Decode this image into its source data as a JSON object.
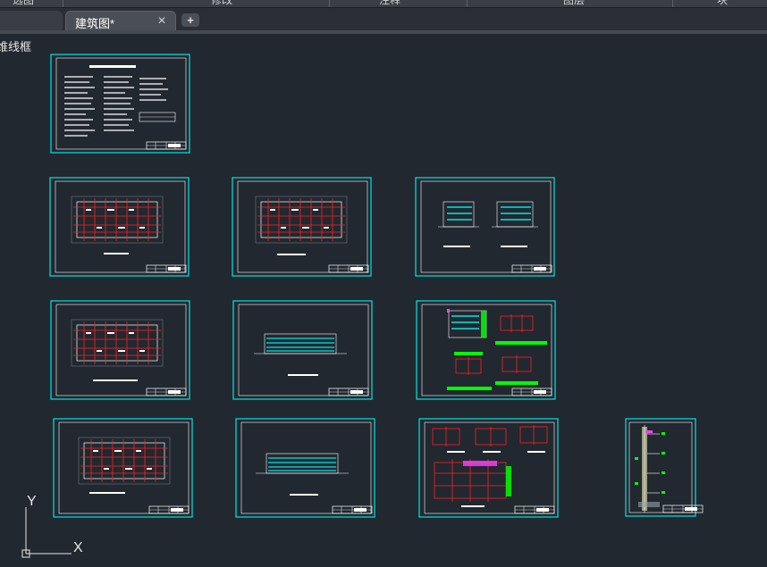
{
  "ribbon": {
    "labels": [
      "选图",
      "修改",
      "注释",
      "图层",
      "块"
    ]
  },
  "tabs": {
    "active_label": "建筑图*",
    "close_glyph": "✕",
    "add_glyph": "+"
  },
  "viewport": {
    "label": "维线框"
  },
  "ucs": {
    "x_label": "X",
    "y_label": "Y"
  },
  "colors": {
    "background": "#212830",
    "sheet_border": "#00e5e5",
    "inner_border": "#ffffff",
    "grid_red": "#ff2020",
    "highlight_green": "#00ff00",
    "highlight_magenta": "#ff40ff"
  }
}
